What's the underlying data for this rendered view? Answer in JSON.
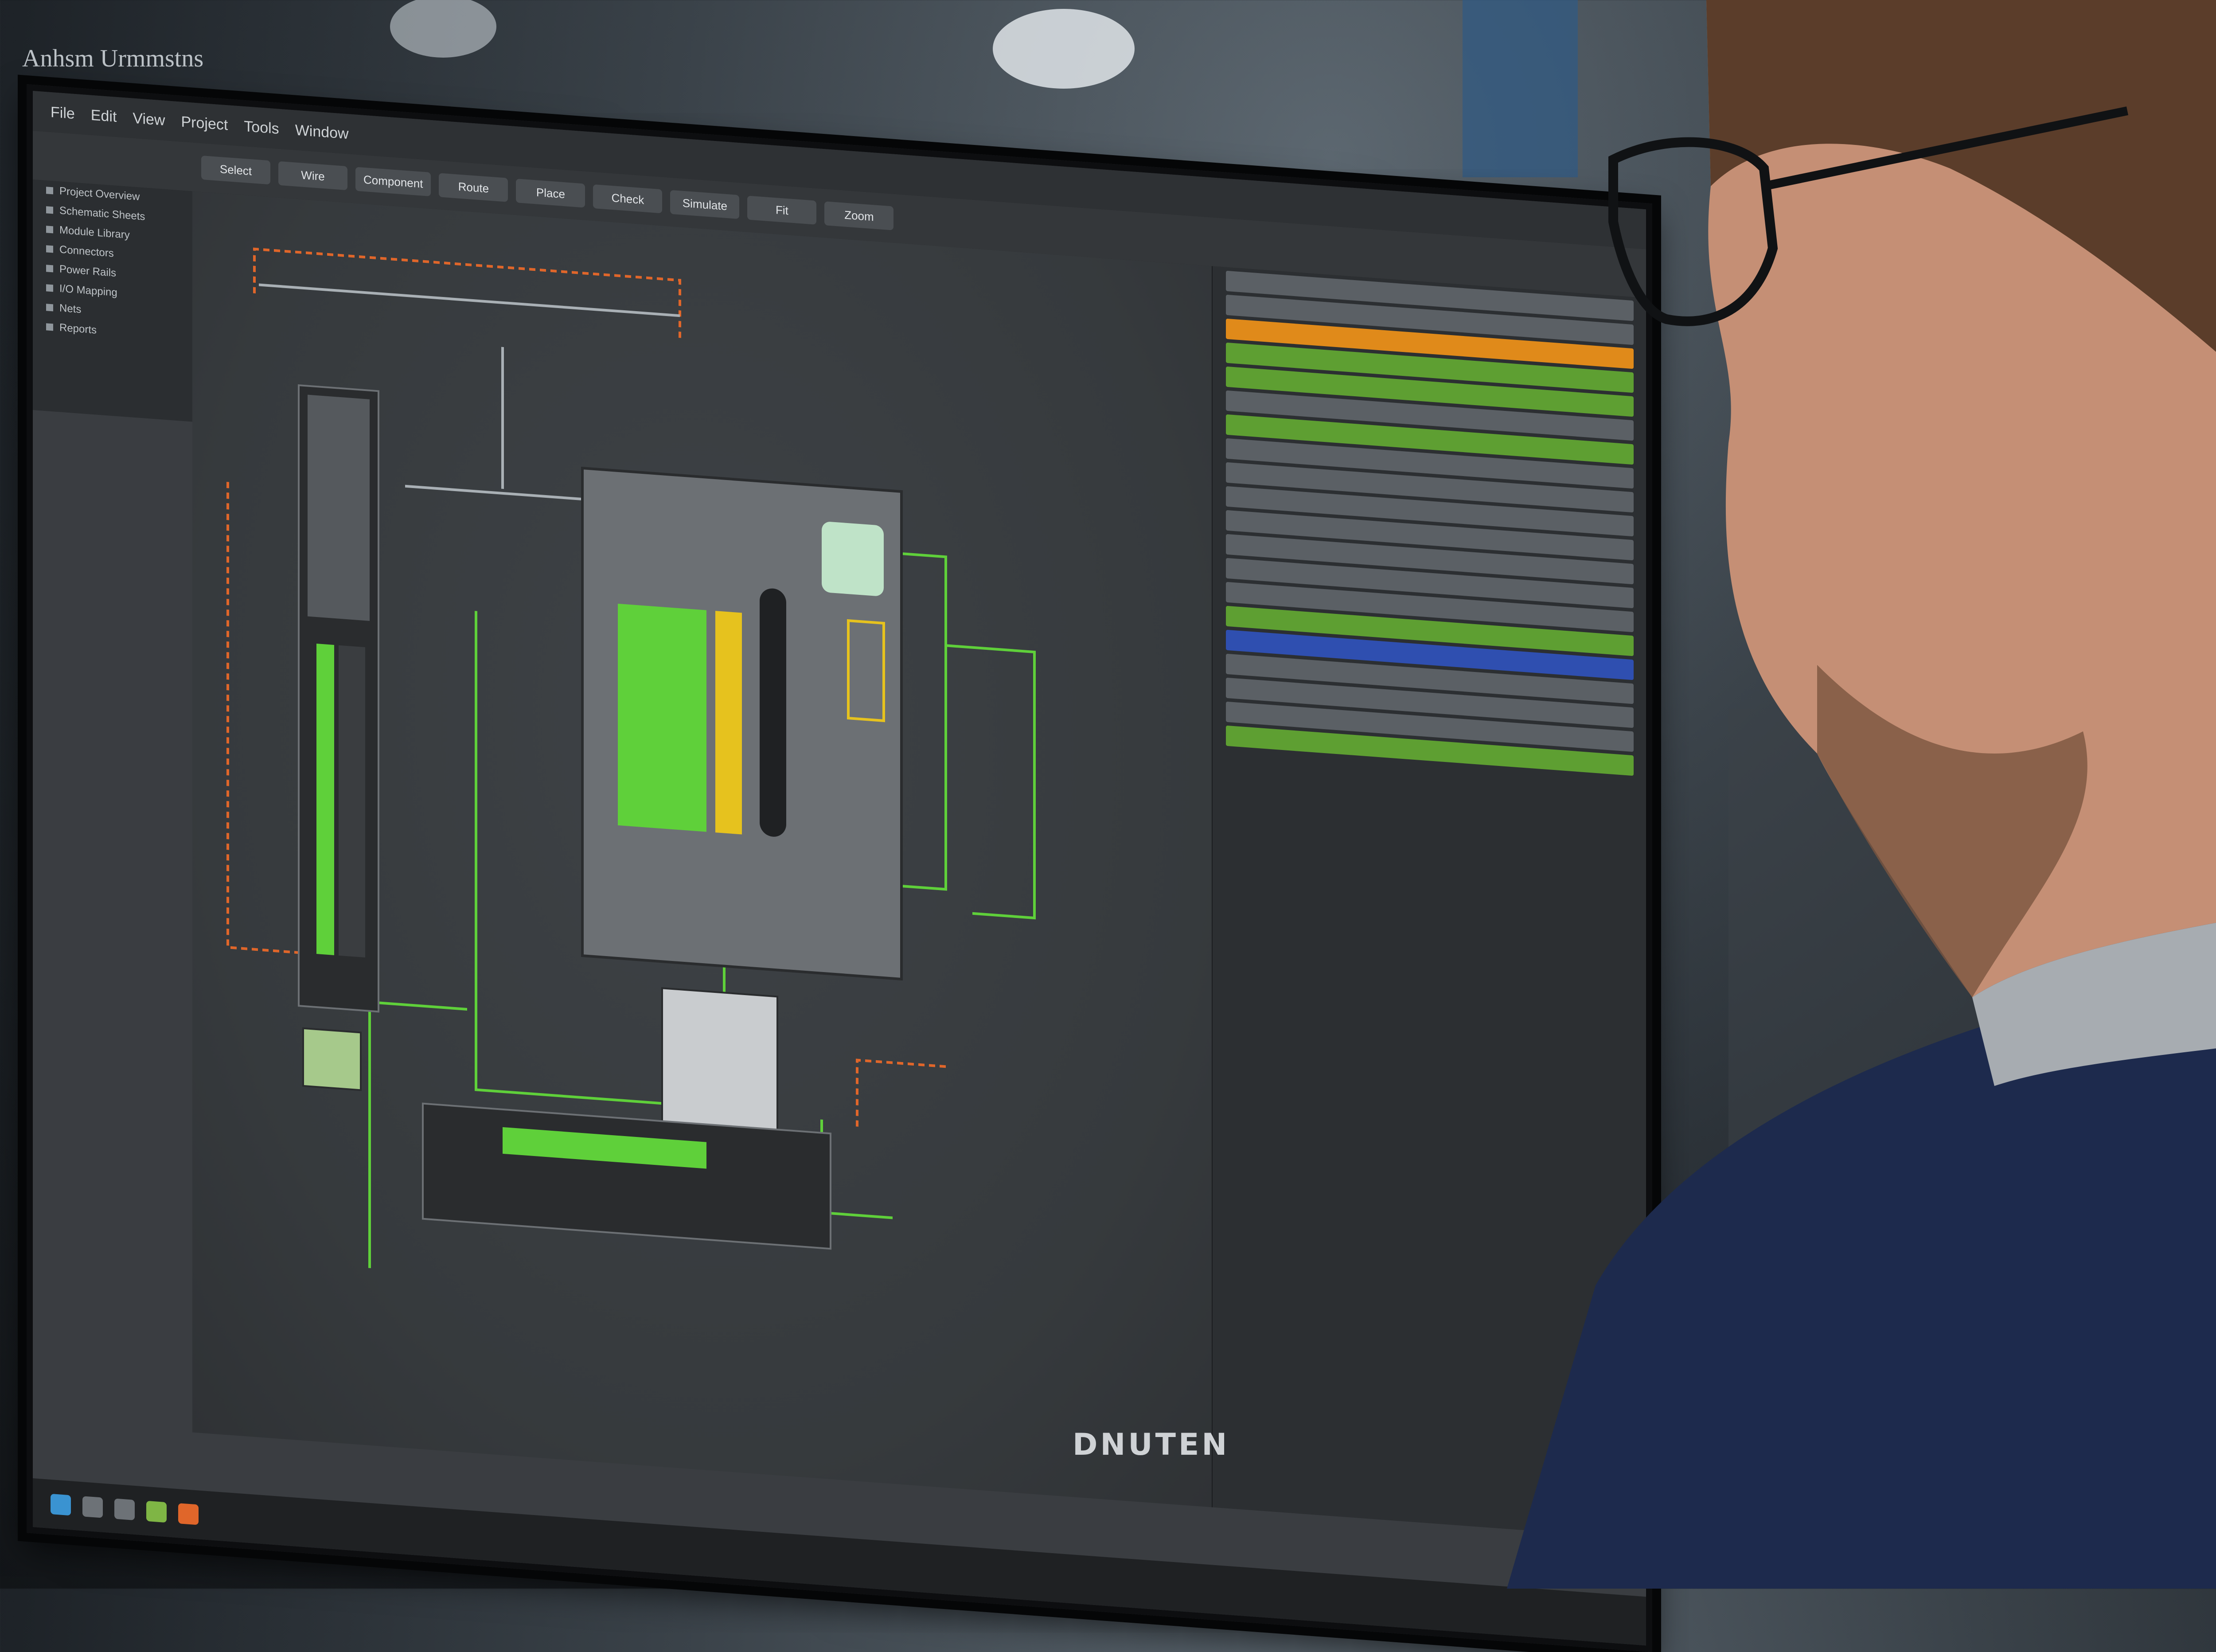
{
  "photo_header_text": "Anhsm Urmmstns",
  "monitor_brand": "DNUTEN",
  "app": {
    "menu_items": [
      "File",
      "Edit",
      "View",
      "Project",
      "Tools",
      "Window"
    ],
    "toolbar_buttons": [
      "Select",
      "Wire",
      "Component",
      "Route",
      "Place",
      "Check",
      "Simulate",
      "Fit",
      "Zoom"
    ],
    "tree_items": [
      "Project Overview",
      "Schematic Sheets",
      "Module Library",
      "Connectors",
      "Power Rails",
      "I/O Mapping",
      "Nets",
      "Reports"
    ],
    "right_panel_rows": [
      "lite",
      "lite",
      "orange",
      "green",
      "green",
      "lite",
      "green",
      "lite",
      "lite",
      "lite",
      "lite",
      "lite",
      "lite",
      "lite",
      "green",
      "blue",
      "lite",
      "lite",
      "lite",
      "green"
    ]
  },
  "colors": {
    "wire_green": "#5fd03a",
    "wire_orange": "#e0662a",
    "wire_grey": "#a9b0b5",
    "module_grey": "#6c7074",
    "highlight_yellow": "#e6c21e",
    "shirt_navy": "#1d2a4d"
  },
  "icons": [
    "windows-start-icon",
    "search-icon",
    "folder-icon",
    "terminal-icon",
    "app-icon"
  ]
}
